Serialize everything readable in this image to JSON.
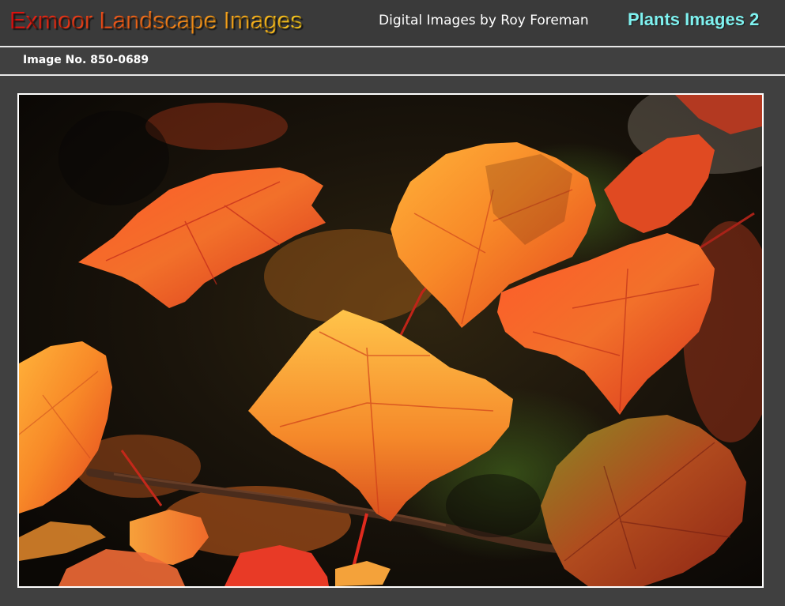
{
  "header": {
    "site_title": "Exmoor Landscape Images",
    "subtitle": "Digital Images by Roy Foreman",
    "section_link": "Plants Images 2"
  },
  "info_bar": {
    "image_number": "Image No. 850-0689"
  },
  "photo": {
    "subject": "autumn-maple-leaves"
  },
  "colors": {
    "background": "#404040",
    "section_link": "#7ff2f0",
    "title_gradient_start": "#e01010",
    "title_gradient_end": "#f7c81e",
    "frame_border": "#ffffff"
  }
}
